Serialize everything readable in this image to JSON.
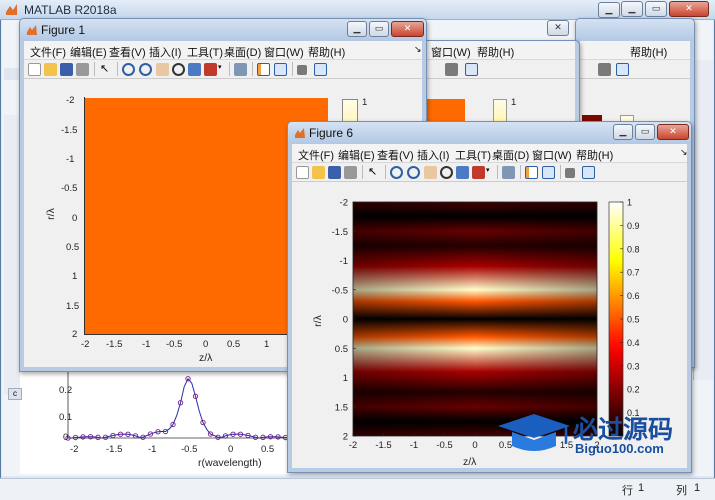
{
  "main_window": {
    "title": "MATLAB R2018a",
    "status_row_label": "行",
    "status_row_value": "1",
    "status_col_label": "列",
    "status_col_value": "1"
  },
  "background_plot": {
    "y_ticks": [
      "0.2",
      "0.1",
      "0"
    ],
    "x_ticks": [
      "-2",
      "-1.5",
      "-1",
      "-0.5",
      "0",
      "0.5",
      "1"
    ],
    "xlabel": "r(wavelength)",
    "line_color": "#1f2fb0",
    "marker_color": "#7a1a8c"
  },
  "figure1": {
    "title": "Figure 1",
    "menu": [
      "文件(F)",
      "编辑(E)",
      "查看(V)",
      "插入(I)",
      "工具(T)",
      "桌面(D)",
      "窗口(W)",
      "帮助(H)"
    ],
    "y_ticks": [
      "-2",
      "-1.5",
      "-1",
      "-0.5",
      "0",
      "0.5",
      "1",
      "1.5",
      "2"
    ],
    "x_ticks": [
      "-2",
      "-1.5",
      "-1",
      "-0.5",
      "0",
      "0.5",
      "1"
    ],
    "xlabel": "z/λ",
    "ylabel": "r/λ",
    "colorbar_top": "1",
    "fill_color": "#ff6a00"
  },
  "figure_behind": {
    "menu": [
      "窗口(W)",
      "帮助(H)"
    ],
    "colorbar_top": "1"
  },
  "figure_behind2": {
    "menu": [
      "帮助(H)"
    ]
  },
  "figure6": {
    "title": "Figure 6",
    "menu": [
      "文件(F)",
      "编辑(E)",
      "查看(V)",
      "插入(I)",
      "工具(T)",
      "桌面(D)",
      "窗口(W)",
      "帮助(H)"
    ],
    "xlabel": "z/λ",
    "ylabel": "r/λ"
  },
  "chart_data": {
    "type": "heatmap",
    "colormap": "hot",
    "xlabel": "z/λ",
    "ylabel": "r/λ",
    "xlim": [
      -2,
      2
    ],
    "ylim": [
      2,
      -2
    ],
    "x_ticks": [
      "-2",
      "-1.5",
      "-1",
      "-0.5",
      "0",
      "0.5",
      "1",
      "1.5",
      "2"
    ],
    "y_ticks": [
      "-2",
      "-1.5",
      "-1",
      "-0.5",
      "0",
      "0.5",
      "1",
      "1.5",
      "2"
    ],
    "colorbar_ticks": [
      "1",
      "0.9",
      "0.8",
      "0.7",
      "0.6",
      "0.5",
      "0.4",
      "0.3",
      "0.2",
      "0.1",
      "0"
    ],
    "clim": [
      0,
      1
    ],
    "r_profile": [
      {
        "r": -2.0,
        "value": 0.1
      },
      {
        "r": -1.75,
        "value": 0.0
      },
      {
        "r": -1.5,
        "value": 0.15
      },
      {
        "r": -1.25,
        "value": 0.05
      },
      {
        "r": -0.9,
        "value": 0.25
      },
      {
        "r": -0.5,
        "value": 0.95
      },
      {
        "r": -0.3,
        "value": 0.5
      },
      {
        "r": 0.0,
        "value": 0.0
      },
      {
        "r": 0.3,
        "value": 0.5
      },
      {
        "r": 0.5,
        "value": 0.95
      },
      {
        "r": 0.9,
        "value": 0.25
      },
      {
        "r": 1.25,
        "value": 0.05
      },
      {
        "r": 1.5,
        "value": 0.15
      },
      {
        "r": 1.75,
        "value": 0.0
      },
      {
        "r": 2.0,
        "value": 0.1
      }
    ]
  },
  "watermark": {
    "main": "必过源码",
    "sub": "Biguo100.com"
  }
}
